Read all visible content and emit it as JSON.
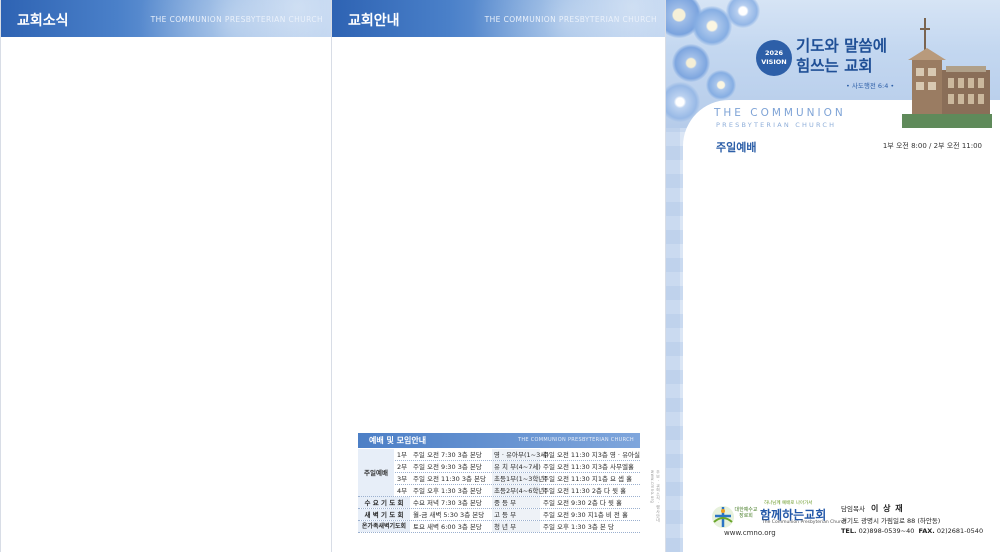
{
  "page1": {
    "title": "교회소식",
    "subtitle": "THE COMMUNION PRESBYTERIAN CHURCH"
  },
  "page2": {
    "title": "교회안내",
    "subtitle": "THE COMMUNION PRESBYTERIAN CHURCH",
    "schedule": {
      "title": "예배 및 모임안내",
      "subtitle": "THE COMMUNION PRESBYTERIAN CHURCH",
      "main_category": "주일예배",
      "rows": [
        {
          "sub": "1부",
          "time": "주일  오전 7:30  3층 본당",
          "group": "영 · 유아부(1~3세)",
          "gtime": "주일 오전 11:30  지3층 영 · 유아실"
        },
        {
          "sub": "2부",
          "time": "주일  오전 9:30  3층 본당",
          "group": "유 치 부(4~7세)",
          "gtime": "주일 오전 11:30  지3층 사무엘홀"
        },
        {
          "sub": "3부",
          "time": "주일  오전 11:30  3층 본당",
          "group": "초등1부(1~3학년)",
          "gtime": "주일 오전 11:30  지1층 요 셉 홀"
        },
        {
          "sub": "4부",
          "time": "주일  오후 1:30  3층 본당",
          "group": "초등2부(4~6학년)",
          "gtime": "주일 오전 11:30  2층 다 윗 홀"
        },
        {
          "cat": "수 요 기 도 회",
          "time": "수요  저녁 7:30  3층 본당",
          "group": "중     등     부",
          "gtime": "주일 오전 9:30  2층 다 윗 홀"
        },
        {
          "cat": "새 벽 기 도 회",
          "time": "월-금  새벽 5:30  3층 본당",
          "group": "고     등     부",
          "gtime": "주일 오전 9:30  지1층 비 전 홀"
        },
        {
          "cat": "온가족새벽기도회",
          "time": "토요  새벽 6:00  3층 본당",
          "group": "청     년     부",
          "gtime": "주일 오후 1:30  3층  본    당"
        }
      ],
      "side_note": "주보 · 교회소식 · 행사안내 www.cmno.org"
    }
  },
  "page3": {
    "vision_year": "2026",
    "vision_label": "VISION",
    "slogan_line1": "기도와 말씀에",
    "slogan_line2": "힘쓰는 교회",
    "verse": "• 사도행전 6:4 •",
    "brand_line1": "THE COMMUNION",
    "brand_line2": "PRESBYTERIAN CHURCH",
    "worship_title": "주일예배",
    "worship_time": "1부 오전 8:00 / 2부 오전 11:00",
    "logo_slogan": "하나님께 예배로 나아가서",
    "logo_denomination": "대한예수교 장로회",
    "logo_name": "함께하는교회",
    "logo_english": "The Communion Presbyterian Church",
    "website": "www.cmno.org",
    "pastor_label": "담임목사",
    "pastor_name": "이 상 재",
    "address": "경기도 광명시 가림일로 88 (하안동)",
    "tel_label": "TEL.",
    "tel": "02)898-0539~40",
    "fax_label": "FAX.",
    "fax": "02)2681-0540"
  }
}
